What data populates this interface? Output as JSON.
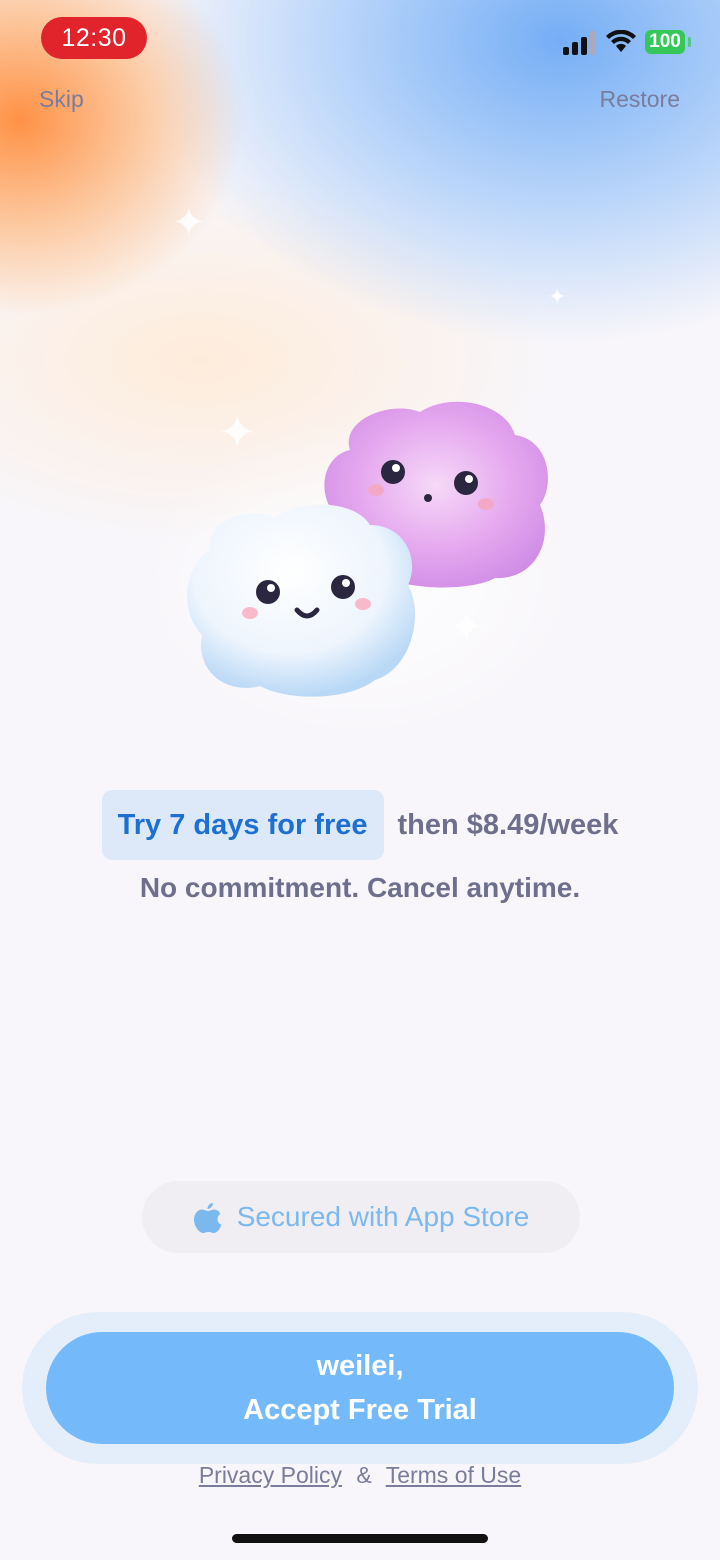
{
  "status_bar": {
    "time": "12:30",
    "battery": "100",
    "icons": [
      "cellular-signal-icon",
      "wifi-icon",
      "battery-icon"
    ]
  },
  "header": {
    "skip_label": "Skip",
    "restore_label": "Restore"
  },
  "offer": {
    "trial_label": "Try 7 days for free",
    "price_label": "then $8.49/week",
    "subtitle": "No commitment. Cancel anytime."
  },
  "secure_badge": {
    "icon": "apple-icon",
    "label": "Secured with App Store"
  },
  "cta": {
    "line1": "weilei,",
    "line2": "Accept Free Trial"
  },
  "footer": {
    "privacy_label": "Privacy Policy",
    "separator": "&",
    "terms_label": "Terms of Use"
  },
  "colors": {
    "accent": "#74bafa",
    "trial_text": "#1d6fd1",
    "recording_pill": "#e1242b",
    "battery": "#35c759"
  }
}
